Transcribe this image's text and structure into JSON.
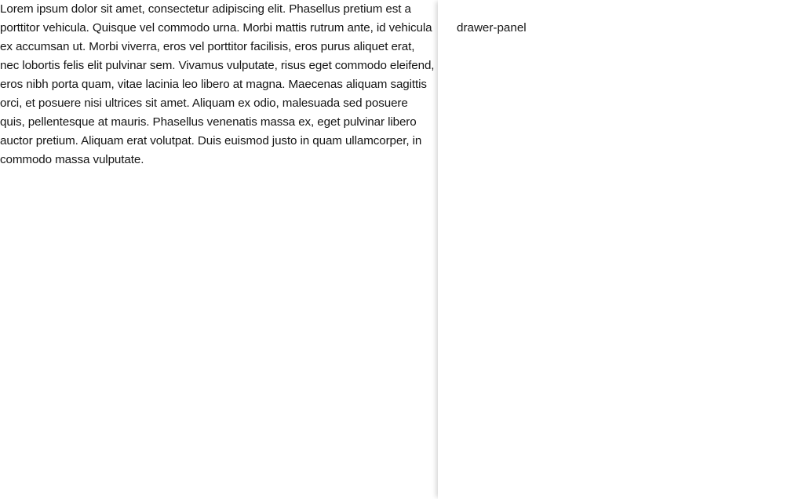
{
  "content": {
    "body_text": "Lorem ipsum dolor sit amet, consectetur adipiscing elit. Phasellus pretium est a porttitor vehicula. Quisque vel commodo urna. Morbi mattis rutrum ante, id vehicula ex accumsan ut. Morbi viverra, eros vel porttitor facilisis, eros purus aliquet erat, nec lobortis felis elit pulvinar sem. Vivamus vulputate, risus eget commodo eleifend, eros nibh porta quam, vitae lacinia leo libero at magna. Maecenas aliquam sagittis orci, et posuere nisi ultrices sit amet. Aliquam ex odio, malesuada sed posuere quis, pellentesque at mauris. Phasellus venenatis massa ex, eget pulvinar libero auctor pretium. Aliquam erat volutpat. Duis euismod justo in quam ullamcorper, in commodo massa vulputate."
  },
  "drawer": {
    "panel_label": "drawer-panel"
  }
}
